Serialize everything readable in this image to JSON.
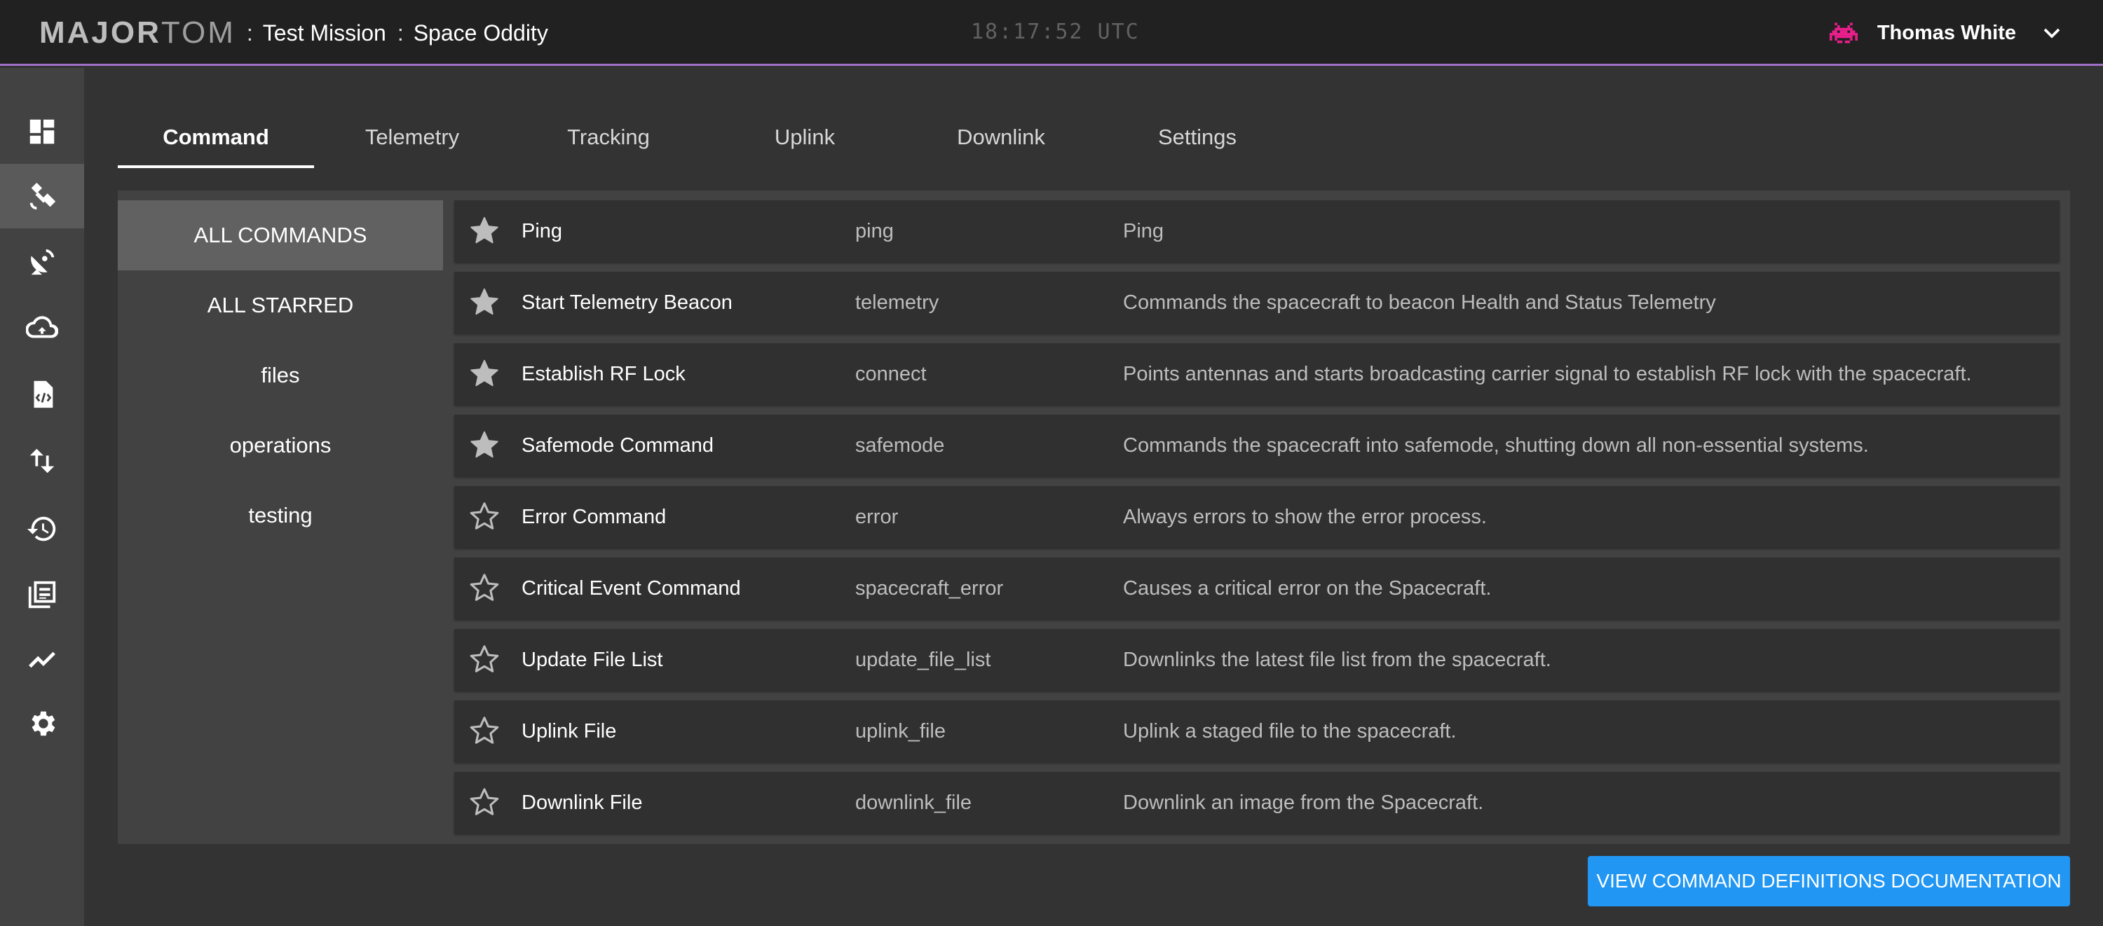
{
  "header": {
    "logo_bold": "MAJOR",
    "logo_light": "TOM",
    "separator": ":",
    "mission": "Test Mission",
    "system": "Space Oddity",
    "clock": "18:17:52 UTC",
    "user_name": "Thomas White",
    "accent_color": "#a070c8"
  },
  "sidebar": {
    "items": [
      {
        "icon": "dashboard-icon"
      },
      {
        "icon": "satellite-icon",
        "active": true
      },
      {
        "icon": "satellite-dish-icon"
      },
      {
        "icon": "cloud-sync-icon"
      },
      {
        "icon": "code-file-icon"
      },
      {
        "icon": "up-down-arrows-icon"
      },
      {
        "icon": "history-icon"
      },
      {
        "icon": "documents-icon"
      },
      {
        "icon": "trending-icon"
      },
      {
        "icon": "gear-icon"
      }
    ]
  },
  "tabs": [
    {
      "label": "Command",
      "active": true
    },
    {
      "label": "Telemetry"
    },
    {
      "label": "Tracking"
    },
    {
      "label": "Uplink"
    },
    {
      "label": "Downlink"
    },
    {
      "label": "Settings"
    }
  ],
  "categories": [
    {
      "label": "ALL COMMANDS",
      "active": true
    },
    {
      "label": "ALL STARRED"
    },
    {
      "label": "files"
    },
    {
      "label": "operations"
    },
    {
      "label": "testing"
    }
  ],
  "commands": [
    {
      "name": "Ping",
      "id": "ping",
      "desc": "Ping",
      "starred": true
    },
    {
      "name": "Start Telemetry Beacon",
      "id": "telemetry",
      "desc": "Commands the spacecraft to beacon Health and Status Telemetry",
      "starred": true
    },
    {
      "name": "Establish RF Lock",
      "id": "connect",
      "desc": "Points antennas and starts broadcasting carrier signal to establish RF lock with the spacecraft.",
      "starred": true
    },
    {
      "name": "Safemode Command",
      "id": "safemode",
      "desc": "Commands the spacecraft into safemode, shutting down all non-essential systems.",
      "starred": true
    },
    {
      "name": "Error Command",
      "id": "error",
      "desc": "Always errors to show the error process.",
      "starred": false
    },
    {
      "name": "Critical Event Command",
      "id": "spacecraft_error",
      "desc": "Causes a critical error on the Spacecraft.",
      "starred": false
    },
    {
      "name": "Update File List",
      "id": "update_file_list",
      "desc": "Downlinks the latest file list from the spacecraft.",
      "starred": false
    },
    {
      "name": "Uplink File",
      "id": "uplink_file",
      "desc": "Uplink a staged file to the spacecraft.",
      "starred": false
    },
    {
      "name": "Downlink File",
      "id": "downlink_file",
      "desc": "Downlink an image from the Spacecraft.",
      "starred": false
    }
  ],
  "docs_button": {
    "label": "VIEW COMMAND DEFINITIONS DOCUMENTATION",
    "color": "#2196f3"
  }
}
